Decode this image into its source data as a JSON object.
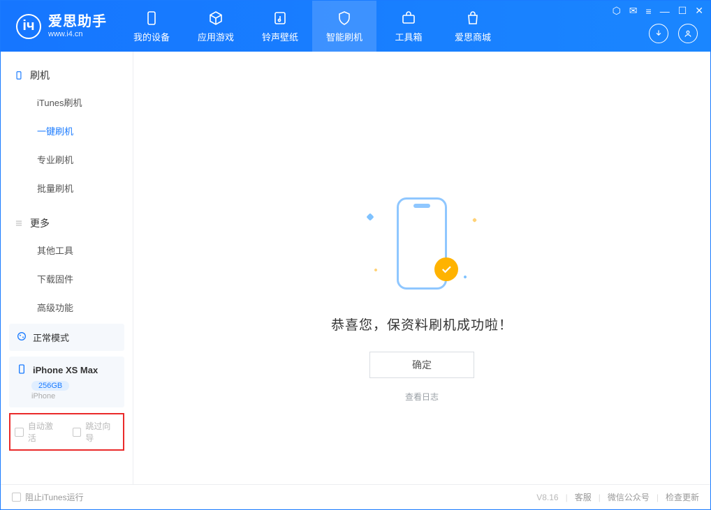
{
  "app": {
    "name_cn": "爱思助手",
    "name_en": "www.i4.cn"
  },
  "tabs": [
    {
      "label": "我的设备",
      "icon": "phone"
    },
    {
      "label": "应用游戏",
      "icon": "cube"
    },
    {
      "label": "铃声壁纸",
      "icon": "music"
    },
    {
      "label": "智能刷机",
      "icon": "shield",
      "active": true
    },
    {
      "label": "工具箱",
      "icon": "toolbox"
    },
    {
      "label": "爱思商城",
      "icon": "bag"
    }
  ],
  "sidebar": {
    "section1": {
      "title": "刷机",
      "items": [
        "iTunes刷机",
        "一键刷机",
        "专业刷机",
        "批量刷机"
      ],
      "active_index": 1
    },
    "section2": {
      "title": "更多",
      "items": [
        "其他工具",
        "下载固件",
        "高级功能"
      ]
    }
  },
  "cards": {
    "mode": "正常模式",
    "device": {
      "name": "iPhone XS Max",
      "capacity": "256GB",
      "type": "iPhone"
    }
  },
  "bottom_checks": {
    "auto_activate": "自动激活",
    "skip_wizard": "跳过向导"
  },
  "result": {
    "message": "恭喜您，保资料刷机成功啦！",
    "ok": "确定",
    "view_log": "查看日志"
  },
  "statusbar": {
    "block_itunes": "阻止iTunes运行",
    "version": "V8.16",
    "links": [
      "客服",
      "微信公众号",
      "检查更新"
    ]
  }
}
